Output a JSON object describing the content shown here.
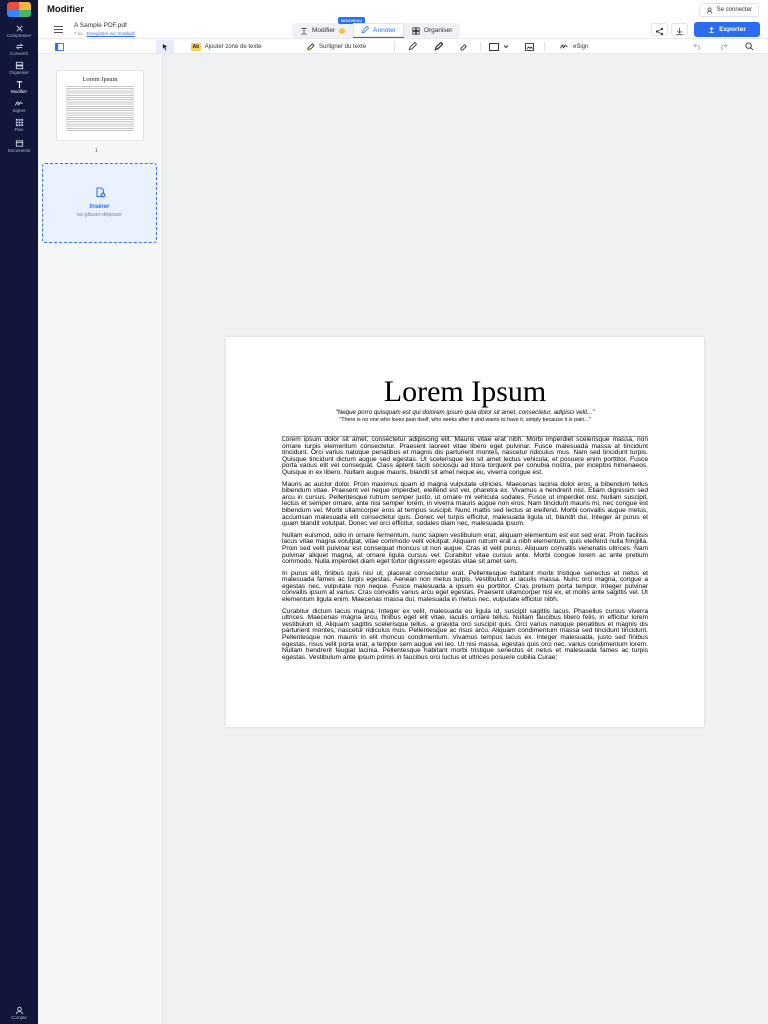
{
  "app": {
    "title": "Modifier"
  },
  "header": {
    "connect_label": "Se connecter"
  },
  "rail": {
    "items": [
      {
        "label": "Compresser",
        "icon": "compress-icon"
      },
      {
        "label": "Convertir",
        "icon": "convert-icon"
      },
      {
        "label": "Organiser",
        "icon": "organize-icon"
      },
      {
        "label": "Modifier",
        "icon": "text-edit-icon"
      },
      {
        "label": "Signer",
        "icon": "signature-icon"
      },
      {
        "label": "Plus",
        "icon": "grid-icon"
      },
      {
        "label": "Documents",
        "icon": "documents-icon"
      }
    ],
    "account_label": "Compte"
  },
  "document": {
    "file_name": "A Sample PDF.pdf",
    "size": "7 ko",
    "save_link": "Enregistrer sur Smallpdf"
  },
  "mode_tabs": {
    "new_badge": "NOUVEAU",
    "tabs": [
      {
        "label": "Modifier",
        "icon": "text-edit-icon"
      },
      {
        "label": "Annoter",
        "icon": "pen-icon"
      },
      {
        "label": "Organiser",
        "icon": "organize-icon"
      }
    ]
  },
  "actions": {
    "export_label": "Exporter"
  },
  "toolbar": {
    "add_text_label": "Ajouter zone de texte",
    "add_text_badge": "Ab",
    "highlight_label": "Surligner du texte",
    "esign_label": "eSign"
  },
  "thumbnails": {
    "page_title": "Lorem Ipsum",
    "page_number": "1",
    "insert_label": "Insérer",
    "insert_sub": "ou glisser-déposer"
  },
  "page": {
    "title": "Lorem Ipsum",
    "quote": "\"Neque porro quisquam est qui dolorem ipsum quia dolor sit amet, consectetur, adipisci velit...\"",
    "subquote": "\"There is no one who loves pain itself, who seeks after it and wants to have it, simply because it is pain...\"",
    "paragraphs": [
      "Lorem ipsum dolor sit amet, consectetur adipiscing elit. Mauris vitae erat nibh. Morbi imperdiet scelerisque massa, non ornare turpis elementum consectetur. Praesent laoreet vitae libero eget pulvinar. Fusce malesuada massa at tincidunt tincidunt. Orci varius natoque penatibus et magnis dis parturient montes, nascetur ridiculus mus. Nam sed tincidunt turpis. Quisque tincidunt dictum augue sed egestas. Ut scelerisque leo sit amet lectus vehicula, et posuere enim porttitor. Fusce porta varius elit vel consequat. Class aptent taciti sociosqu ad litora torquent per conubia nostra, per inceptos himenaeos. Quisque in ex libero. Nullam augue mauris, blandit sit amet neque eu, viverra congue est.",
      "Mauris ac auctor dolor. Proin maximus quam id magna vulputate ultricies. Maecenas lacinia dolor eros, a bibendum tellus bibendum vitae. Praesent vel neque imperdiet, eleifend est vel, pharetra ex. Vivamus a hendrerit nisl. Etiam dignissim sed arcu in cursus. Pellentesque rutrum semper justo, ut ornare mi vehicula sodales. Fusce ut imperdiet nisl. Nullam suscipit, lectus et semper ornare, ante nisi semper lorem, in viverra mauris augue non eros. Nam tincidunt mauris mi, nec congue est bibendum vel. Morbi ullamcorper eros at tempus suscipit. Nunc mattis sed lectus at eleifend. Morbi convallis augue metus, accumsan malesuada elit consectetur quis. Donec vel turpis efficitur, malesuada ligula ut, blandit dui. Integer at purus et quam blandit volutpat. Donec vel orci efficitur, sodales diam nec, malesuada ipsum.",
      "Nullam euismod, odio in ornare fermentum, nunc sapien vestibulum erat, aliquam elementum est est sed erat. Proin facilisis lacus vitae magna volutpat, vitae commodo velit volutpat. Aliquam rutrum erat a nibh elementum, quis eleifend nulla fringilla. Proin sed velit pulvinar est consequat rhoncus ut non augue. Cras id velit purus. Aliquam convallis venenatis ultrices. Nam pulvinar aliquet magna, at ornare ligula cursus vel. Curabitur vitae cursus ante. Morbi congue lorem ac ante pretium commodo. Nulla imperdiet diam eget tortor dignissim egestas vitae sit amet sem.",
      "In purus elit, finibus quis nisi ut, placerat consectetur erat. Pellentesque habitant morbi tristique senectus et netus et malesuada fames ac turpis egestas. Aenean non metus turpis. Vestibulum at iaculis massa. Nunc orci magna, congue a egestas nec, vulputate non neque. Fusce malesuada a ipsum eu porttitor. Cras pretium porta tempor. Integer pulvinar convallis ipsum at varius. Cras convallis varius arcu eget egestas. Praesent ullamcorper nisl ex, et mollis ante sagittis vel. Ut elementum ligula enim. Maecenas massa dui, malesuada in metus nec, vulputate efficitur nibh.",
      "Curabitur dictum lacus magna. Integer ex velit, malesuada eu ligula id, suscipit sagittis lacus. Phasellus cursus viverra ultrices. Maecenas magna arcu, finibus eget elit vitae, iaculis ornare tellus. Nullam faucibus libero felis, in efficitur lorem vestibulum id. Aliquam sagittis scelerisque tellus, a gravida orci suscipit quis. Orci varius natoque penatibus et magnis dis parturient montes, nascetur ridiculus mus. Pellentesque ac risus arcu. Aliquam condimentum massa sed tincidunt tincidunt. Pellentesque non mauris in elit rhoncus condimentum. Vivamus tempus lacus ex. Integer malesuada, justo sed finibus egestas, risus velit porta erat, a tempor sem augue vel leo. Ut nisi massa, egestas quis orci nec, varius condimentum lorem. Nullam hendrerit feugiat lacinia. Pellentesque habitant morbi tristique senectus et netus et malesuada fames ac turpis egestas. Vestibulum ante ipsum primis in faucibus orci luctus et ultrices posuere cubilia Curae;"
    ]
  },
  "colors": {
    "accent": "#2b6cf0",
    "rail": "#11163a",
    "workspace": "#f0f1f3"
  }
}
